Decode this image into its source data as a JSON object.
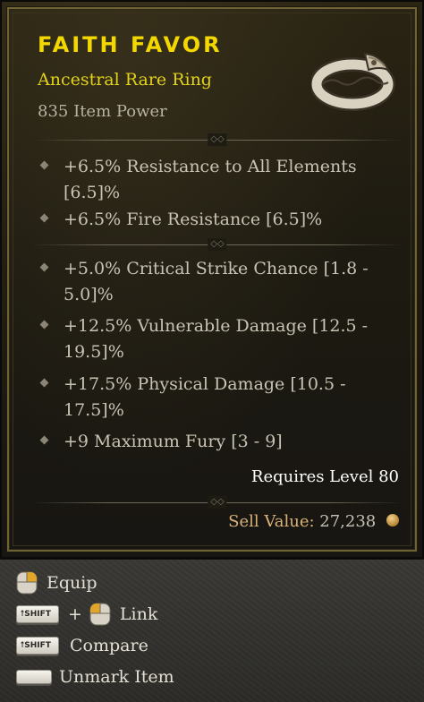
{
  "item": {
    "name": "FAITH FAVOR",
    "type": "Ancestral Rare Ring",
    "item_power": "835 Item Power",
    "affixes_group1": [
      "+6.5% Resistance to All Elements [6.5]%",
      "+6.5% Fire Resistance [6.5]%"
    ],
    "affixes_group2": [
      "+5.0% Critical Strike Chance [1.8 - 5.0]%",
      "+12.5% Vulnerable Damage [12.5 - 19.5]%",
      "+17.5% Physical Damage [10.5 - 17.5]%",
      "+9 Maximum Fury [3 - 9]"
    ],
    "requirement": "Requires Level 80",
    "sell_label": "Sell Value:",
    "sell_value": "27,238",
    "separator_glyph": "◇◇"
  },
  "actions": {
    "equip": "Equip",
    "link": "Link",
    "compare": "Compare",
    "unmark": "Unmark Item",
    "shift_key": "⭡SHIFT",
    "plus": "+"
  },
  "colors": {
    "title": "#f2d800",
    "subtitle": "#e3d11a",
    "affix_text": "#c9c3b4",
    "sell_label": "#d9b277",
    "border_gold": "#6f6233"
  },
  "icons": [
    "ring-icon",
    "mouse-left-icon",
    "mouse-right-icon",
    "gold-coin-icon",
    "shift-key-icon",
    "spacebar-key-icon"
  ]
}
